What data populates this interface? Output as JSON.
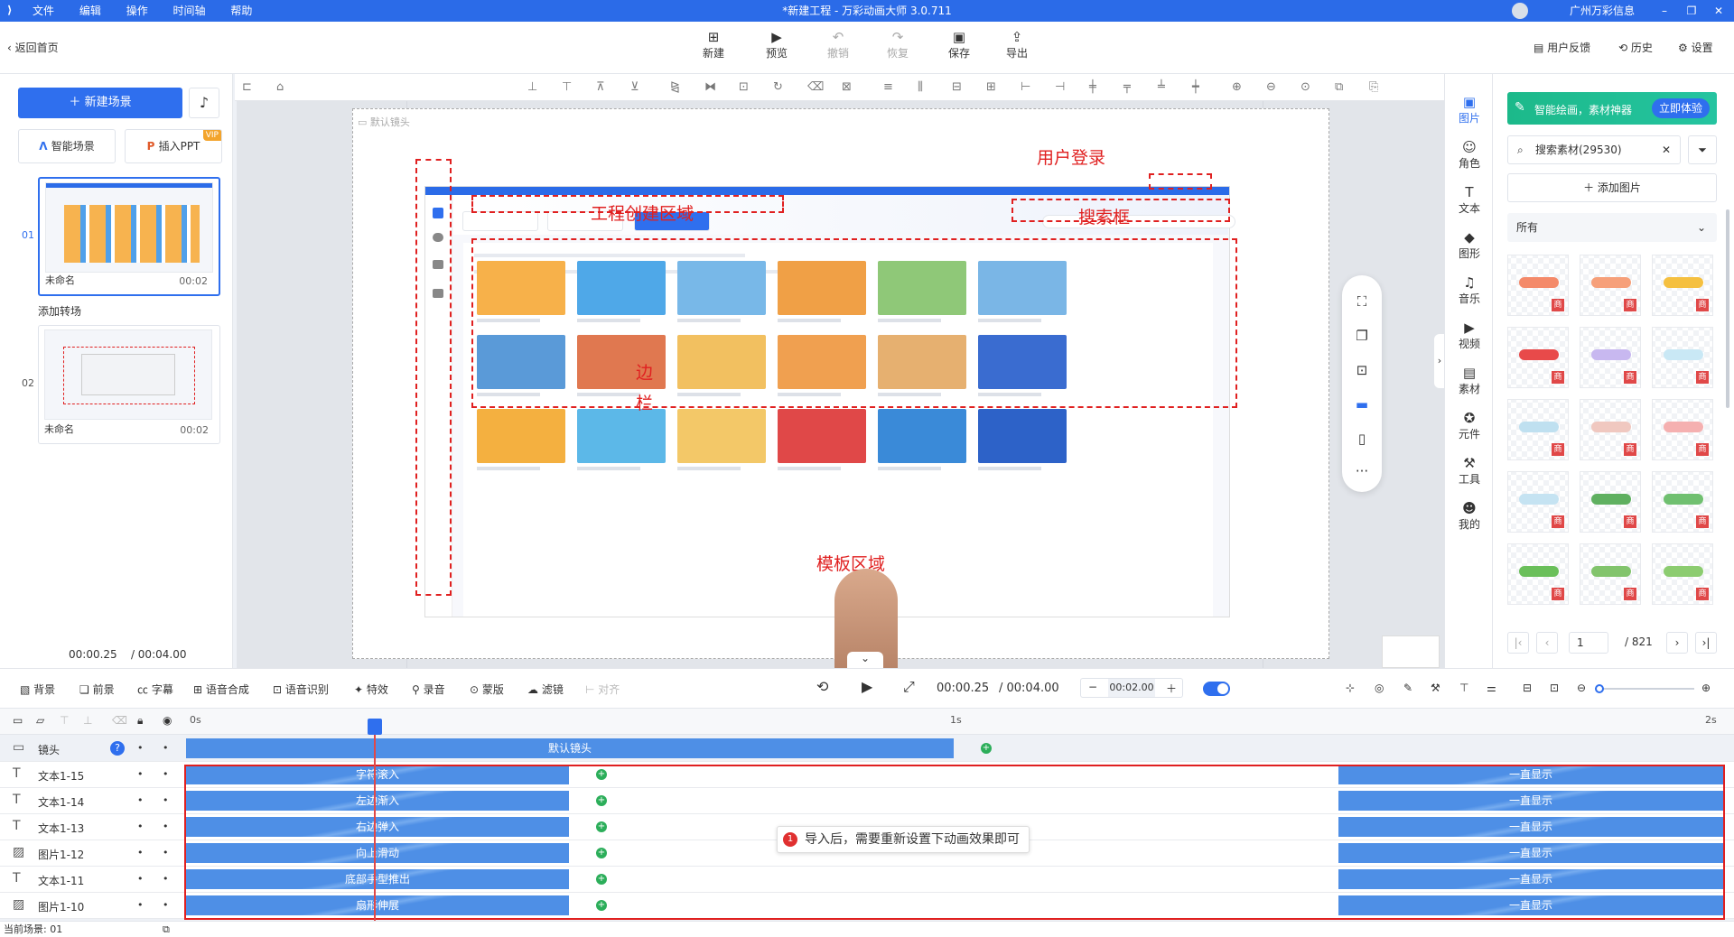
{
  "window": {
    "title": "*新建工程 - 万彩动画大师 3.0.711",
    "menu": [
      "文件",
      "编辑",
      "操作",
      "时间轴",
      "帮助"
    ],
    "user": "广州万彩信息"
  },
  "toolbar": {
    "back": "返回首页",
    "buttons": [
      {
        "label": "新建",
        "icon": "new-icon",
        "enabled": true
      },
      {
        "label": "预览",
        "icon": "play-icon",
        "enabled": true
      },
      {
        "label": "撤销",
        "icon": "undo-icon",
        "enabled": false
      },
      {
        "label": "恢复",
        "icon": "redo-icon",
        "enabled": false
      },
      {
        "label": "保存",
        "icon": "save-icon",
        "enabled": true
      },
      {
        "label": "导出",
        "icon": "export-icon",
        "enabled": true
      }
    ],
    "feedback": "用户反馈",
    "history": "历史",
    "settings": "设置"
  },
  "left": {
    "new_scene": "新建场景",
    "ai_scene": "智能场景",
    "insert_ppt": "插入PPT",
    "vip": "VIP",
    "scenes": [
      {
        "index": "01",
        "name": "未命名",
        "duration": "00:02"
      },
      {
        "index": "02",
        "name": "未命名",
        "duration": "00:02"
      }
    ],
    "add_transition": "添加转场",
    "time_current": "00:00.25",
    "time_total": "/ 00:04.00"
  },
  "canvas": {
    "camera_label": "默认镜头",
    "annotations": {
      "user_login": "用户登录",
      "project_area": "工程创建区域",
      "search_box": "搜索框",
      "sidebar": "边栏",
      "template_area": "模板区域"
    }
  },
  "rightIcons": [
    {
      "label": "图片",
      "icon": "image-icon",
      "selected": true
    },
    {
      "label": "角色",
      "icon": "role-icon"
    },
    {
      "label": "文本",
      "icon": "text-icon"
    },
    {
      "label": "图形",
      "icon": "shape-icon"
    },
    {
      "label": "音乐",
      "icon": "music-icon"
    },
    {
      "label": "视频",
      "icon": "video-icon"
    },
    {
      "label": "素材",
      "icon": "material-icon"
    },
    {
      "label": "元件",
      "icon": "component-icon"
    },
    {
      "label": "工具",
      "icon": "tool-icon"
    },
    {
      "label": "我的",
      "icon": "my-icon"
    }
  ],
  "rightPanel": {
    "ai_text": "智能绘画，素材神器",
    "ai_button": "立即体验",
    "search_placeholder": "搜索素材(29530)",
    "add_image": "添加图片",
    "filter": "所有",
    "shop_badge": "商",
    "page_current": "1",
    "page_total": "/ 821"
  },
  "timelineBar": {
    "tools": [
      "背景",
      "前景",
      "字幕",
      "语音合成",
      "语音识别",
      "特效",
      "录音",
      "蒙版",
      "滤镜",
      "对齐"
    ],
    "time_current": "00:00.25",
    "time_total": "/ 00:04.00",
    "zoom_value": "00:02.00"
  },
  "timeline": {
    "ticks": [
      "0s",
      "1s",
      "2s"
    ],
    "camera_track": {
      "name": "镜头",
      "clip": "默认镜头"
    },
    "tracks": [
      {
        "name": "文本1-15",
        "type": "text",
        "in": "字符滚入",
        "out": "一直显示"
      },
      {
        "name": "文本1-14",
        "type": "text",
        "in": "左边渐入",
        "out": "一直显示"
      },
      {
        "name": "文本1-13",
        "type": "text",
        "in": "右边弹入",
        "out": "一直显示"
      },
      {
        "name": "图片1-12",
        "type": "image",
        "in": "向上滑动",
        "out": "一直显示"
      },
      {
        "name": "文本1-11",
        "type": "text",
        "in": "底部手型推出",
        "out": "一直显示"
      },
      {
        "name": "图片1-10",
        "type": "image",
        "in": "扇形伸展",
        "out": "一直显示"
      }
    ],
    "tip_number": "1",
    "tip": "导入后，需要重新设置下动画效果即可",
    "status": "当前场景: 01"
  }
}
